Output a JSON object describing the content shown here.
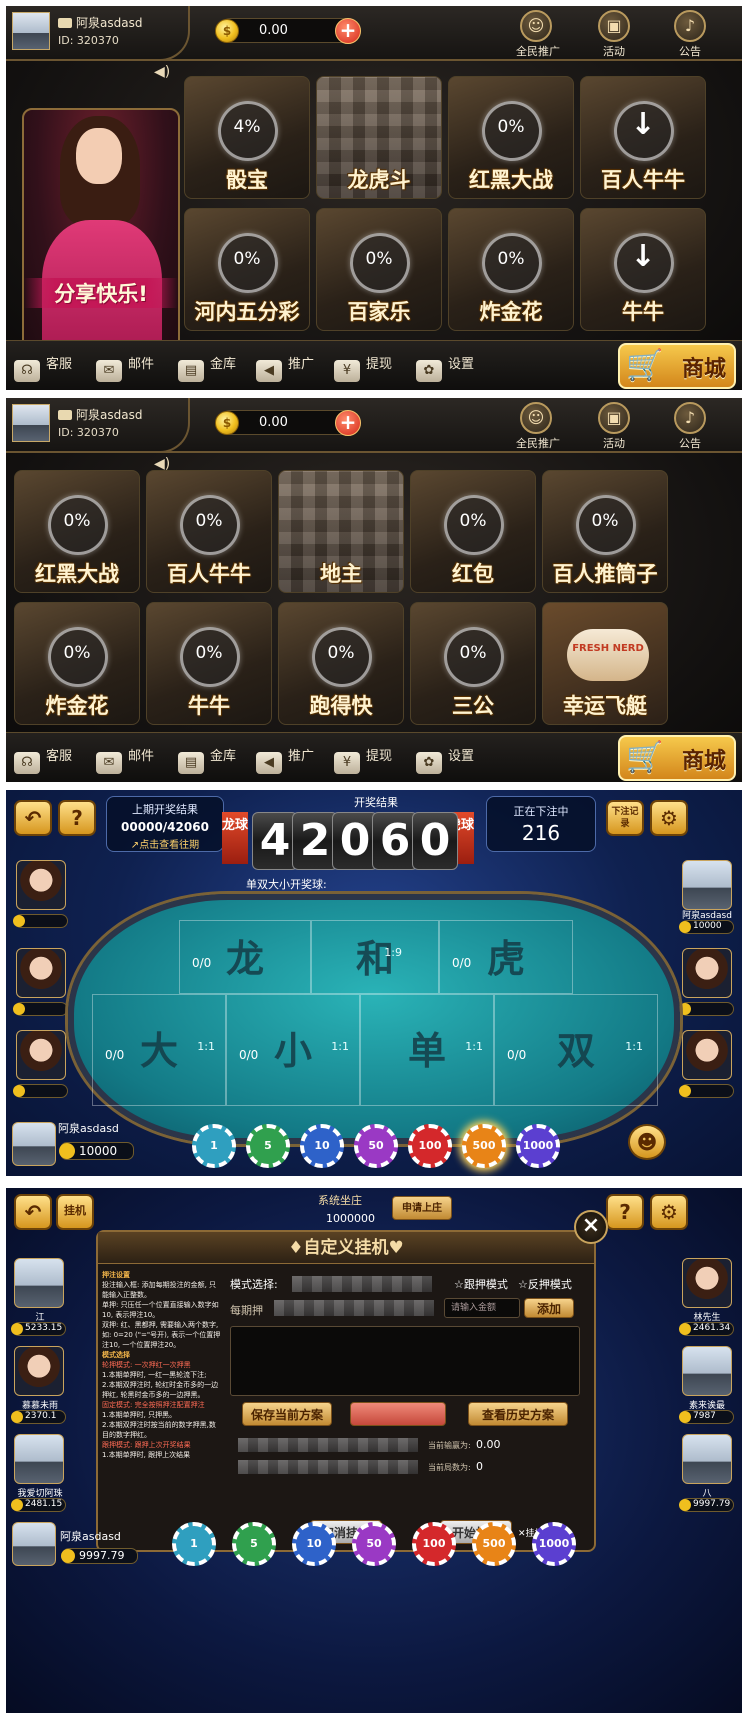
{
  "lobby1": {
    "user": {
      "name": "阿泉asdasd",
      "id": "ID: 320370"
    },
    "balance": "0.00",
    "plus": "+",
    "coin_symbol": "$",
    "top_icons": [
      {
        "label": "全民推广",
        "icon": "promote-icon"
      },
      {
        "label": "活动",
        "icon": "gift-icon"
      },
      {
        "label": "公告",
        "icon": "bell-icon"
      }
    ],
    "banner_text": "分享快乐!",
    "tiles": [
      {
        "name": "骰宝",
        "progress": "4%"
      },
      {
        "name": "龙虎斗",
        "progress": ""
      },
      {
        "name": "红黑大战",
        "progress": "0%"
      },
      {
        "name": "百人牛牛",
        "progress": "↓"
      },
      {
        "name": "河内五分彩",
        "progress": "0%"
      },
      {
        "name": "百家乐",
        "progress": "0%"
      },
      {
        "name": "炸金花",
        "progress": "0%"
      },
      {
        "name": "牛牛",
        "progress": "↓"
      }
    ],
    "bottom": [
      {
        "label": "客服",
        "icon": "headset-icon"
      },
      {
        "label": "邮件",
        "icon": "mail-icon"
      },
      {
        "label": "金库",
        "icon": "safe-icon"
      },
      {
        "label": "推广",
        "icon": "megaphone-icon"
      },
      {
        "label": "提现",
        "icon": "withdraw-icon"
      },
      {
        "label": "设置",
        "icon": "gear-icon"
      }
    ],
    "shop": "商城"
  },
  "lobby2": {
    "tiles": [
      {
        "name": "红黑大战",
        "progress": "0%"
      },
      {
        "name": "百人牛牛",
        "progress": "0%"
      },
      {
        "name": "地主",
        "progress": ""
      },
      {
        "name": "红包",
        "progress": "0%"
      },
      {
        "name": "百人推筒子",
        "progress": "0%"
      },
      {
        "name": "炸金花",
        "progress": "0%"
      },
      {
        "name": "牛牛",
        "progress": "0%"
      },
      {
        "name": "跑得快",
        "progress": "0%"
      },
      {
        "name": "三公",
        "progress": "0%"
      },
      {
        "name": "幸运飞艇",
        "progress": ""
      }
    ],
    "last_tile_badge": "FRESH NERD"
  },
  "game": {
    "last_draw_label": "上期开奖结果",
    "last_draw_value": "00000/42060",
    "history_link": "点击查看往期",
    "result_label": "开奖结果",
    "digits": [
      "4",
      "2",
      "0",
      "6",
      "0"
    ],
    "left_tag": "龙球",
    "right_tag": "虎球",
    "betting_label": "正在下注中",
    "countdown": "216",
    "record_label": "下注记录",
    "odd_even_label": "单双大小开奖球:",
    "cells": [
      {
        "name": "龙",
        "count": "0/0",
        "odds": ""
      },
      {
        "name": "和",
        "count": "",
        "odds": "1:9"
      },
      {
        "name": "虎",
        "count": "0/0",
        "odds": ""
      },
      {
        "name": "大",
        "count": "0/0",
        "odds": "1:1"
      },
      {
        "name": "小",
        "count": "0/0",
        "odds": "1:1"
      },
      {
        "name": "单",
        "count": "",
        "odds": "1:1"
      },
      {
        "name": "双",
        "count": "0/0",
        "odds": "1:1"
      }
    ],
    "right_player": {
      "name": "阿泉asdasd",
      "balance": "10000"
    },
    "self_player": {
      "name": "阿泉asdasd",
      "balance": "10000"
    },
    "chips": [
      {
        "value": "1",
        "color": "#2f9fbf"
      },
      {
        "value": "5",
        "color": "#30a04e"
      },
      {
        "value": "10",
        "color": "#2e62c9"
      },
      {
        "value": "50",
        "color": "#9a39c4"
      },
      {
        "value": "100",
        "color": "#d4282b"
      },
      {
        "value": "500",
        "color": "#e88417"
      },
      {
        "value": "1000",
        "color": "#5b3fd0"
      }
    ]
  },
  "auto": {
    "banker_label": "系统坐庄",
    "banker_balance": "1000000",
    "apply_banker": "申请上庄",
    "hang_label": "挂机",
    "title": "自定义挂机",
    "rules": [
      {
        "t": "押注设置",
        "c": "h"
      },
      {
        "t": "投注输入框: 添加每期投注的金额, 只能输入正整数。",
        "c": ""
      },
      {
        "t": "单押: 只压任一个位置直接输入数字如10, 表示押注10。",
        "c": ""
      },
      {
        "t": "双押: 红、黑都押, 需要输入两个数字, 如: 0=20 (\"=\"号开), 表示一个位置押注10, 一个位置押注20。",
        "c": ""
      },
      {
        "t": "模式选择",
        "c": "h"
      },
      {
        "t": "轮押模式: 一次押红一次押黑",
        "c": "r"
      },
      {
        "t": "1.本期单押时, 一红一黑轮流下注;",
        "c": ""
      },
      {
        "t": "2.本期双押注时, 轮红时金币多的一边押红, 轮黑时金币多的一边押黑。",
        "c": ""
      },
      {
        "t": "固定模式: 完全按照押注配置押注",
        "c": "r"
      },
      {
        "t": "1.本期单押时, 只押黑。",
        "c": ""
      },
      {
        "t": "2.本期双押注时按当前的数字押黑,数目的数字押红。",
        "c": ""
      },
      {
        "t": "跟押模式: 跟押上次开奖结果",
        "c": "r"
      },
      {
        "t": "1.本期单押时, 跟押上次结果",
        "c": ""
      }
    ],
    "mode_label": "模式选择:",
    "mode_follow": "跟押模式",
    "mode_reverse": "反押模式",
    "each_label": "每期押",
    "amount_placeholder": "请输入金额",
    "add_btn": "添加",
    "save_btn": "保存当前方案",
    "history_btn": "查看历史方案",
    "current_win_label": "当前输赢为:",
    "current_win": "0.00",
    "current_rounds_label": "当前局数为:",
    "current_rounds": "0",
    "cancel_btn": "取消挂机",
    "start_btn": "开始挂机",
    "log_btn": "挂机记录",
    "close": "×",
    "left_players": [
      {
        "name": "江",
        "balance": "5233.15"
      },
      {
        "name": "慕慕未雨",
        "balance": "2370.1"
      },
      {
        "name": "我爱切阿珠",
        "balance": "2481.15"
      }
    ],
    "right_players": [
      {
        "name": "林先生",
        "balance": "2461.34"
      },
      {
        "name": "素来诶最",
        "balance": "7987"
      },
      {
        "name": "八",
        "balance": "9997.79"
      }
    ],
    "self": {
      "name": "阿泉asdasd",
      "balance": "9997.79"
    },
    "chips": [
      "1",
      "5",
      "10",
      "50",
      "100",
      "500",
      "1000"
    ]
  }
}
